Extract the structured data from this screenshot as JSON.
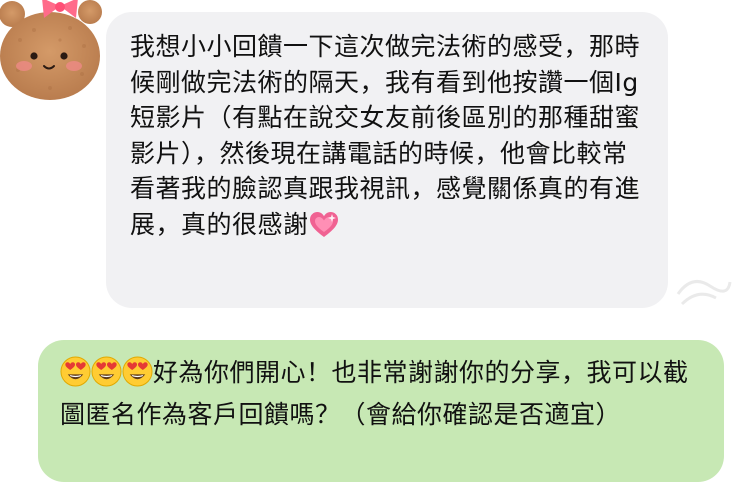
{
  "avatar": {
    "icon": "bear-with-pink-bow-icon",
    "fur_color": "#c98f5f",
    "bow_color": "#ff6b8a"
  },
  "incoming_message": {
    "text": "我想小小回饋一下這次做完法術的感受，那時候剛做完法術的隔天，我有看到他按讚一個Ig短影片（有點在說交女友前後區別的那種甜蜜影片），然後現在講電話的時候，他會比較常看著我的臉認真跟我視訊，感覺關係真的有進展，真的很感謝",
    "trailing_emoji": "sparkling-heart-icon",
    "bubble_color": "#f1f1f3"
  },
  "outgoing_message": {
    "leading_emojis": [
      "heart-eyes-face-icon",
      "heart-eyes-face-icon",
      "heart-eyes-face-icon"
    ],
    "text": "好為你們開心！也非常謝謝你的分享，我可以截圖匿名作為客戶回饋嗎？（會給你確認是否適宜）",
    "bubble_color": "#c7e8b4"
  }
}
